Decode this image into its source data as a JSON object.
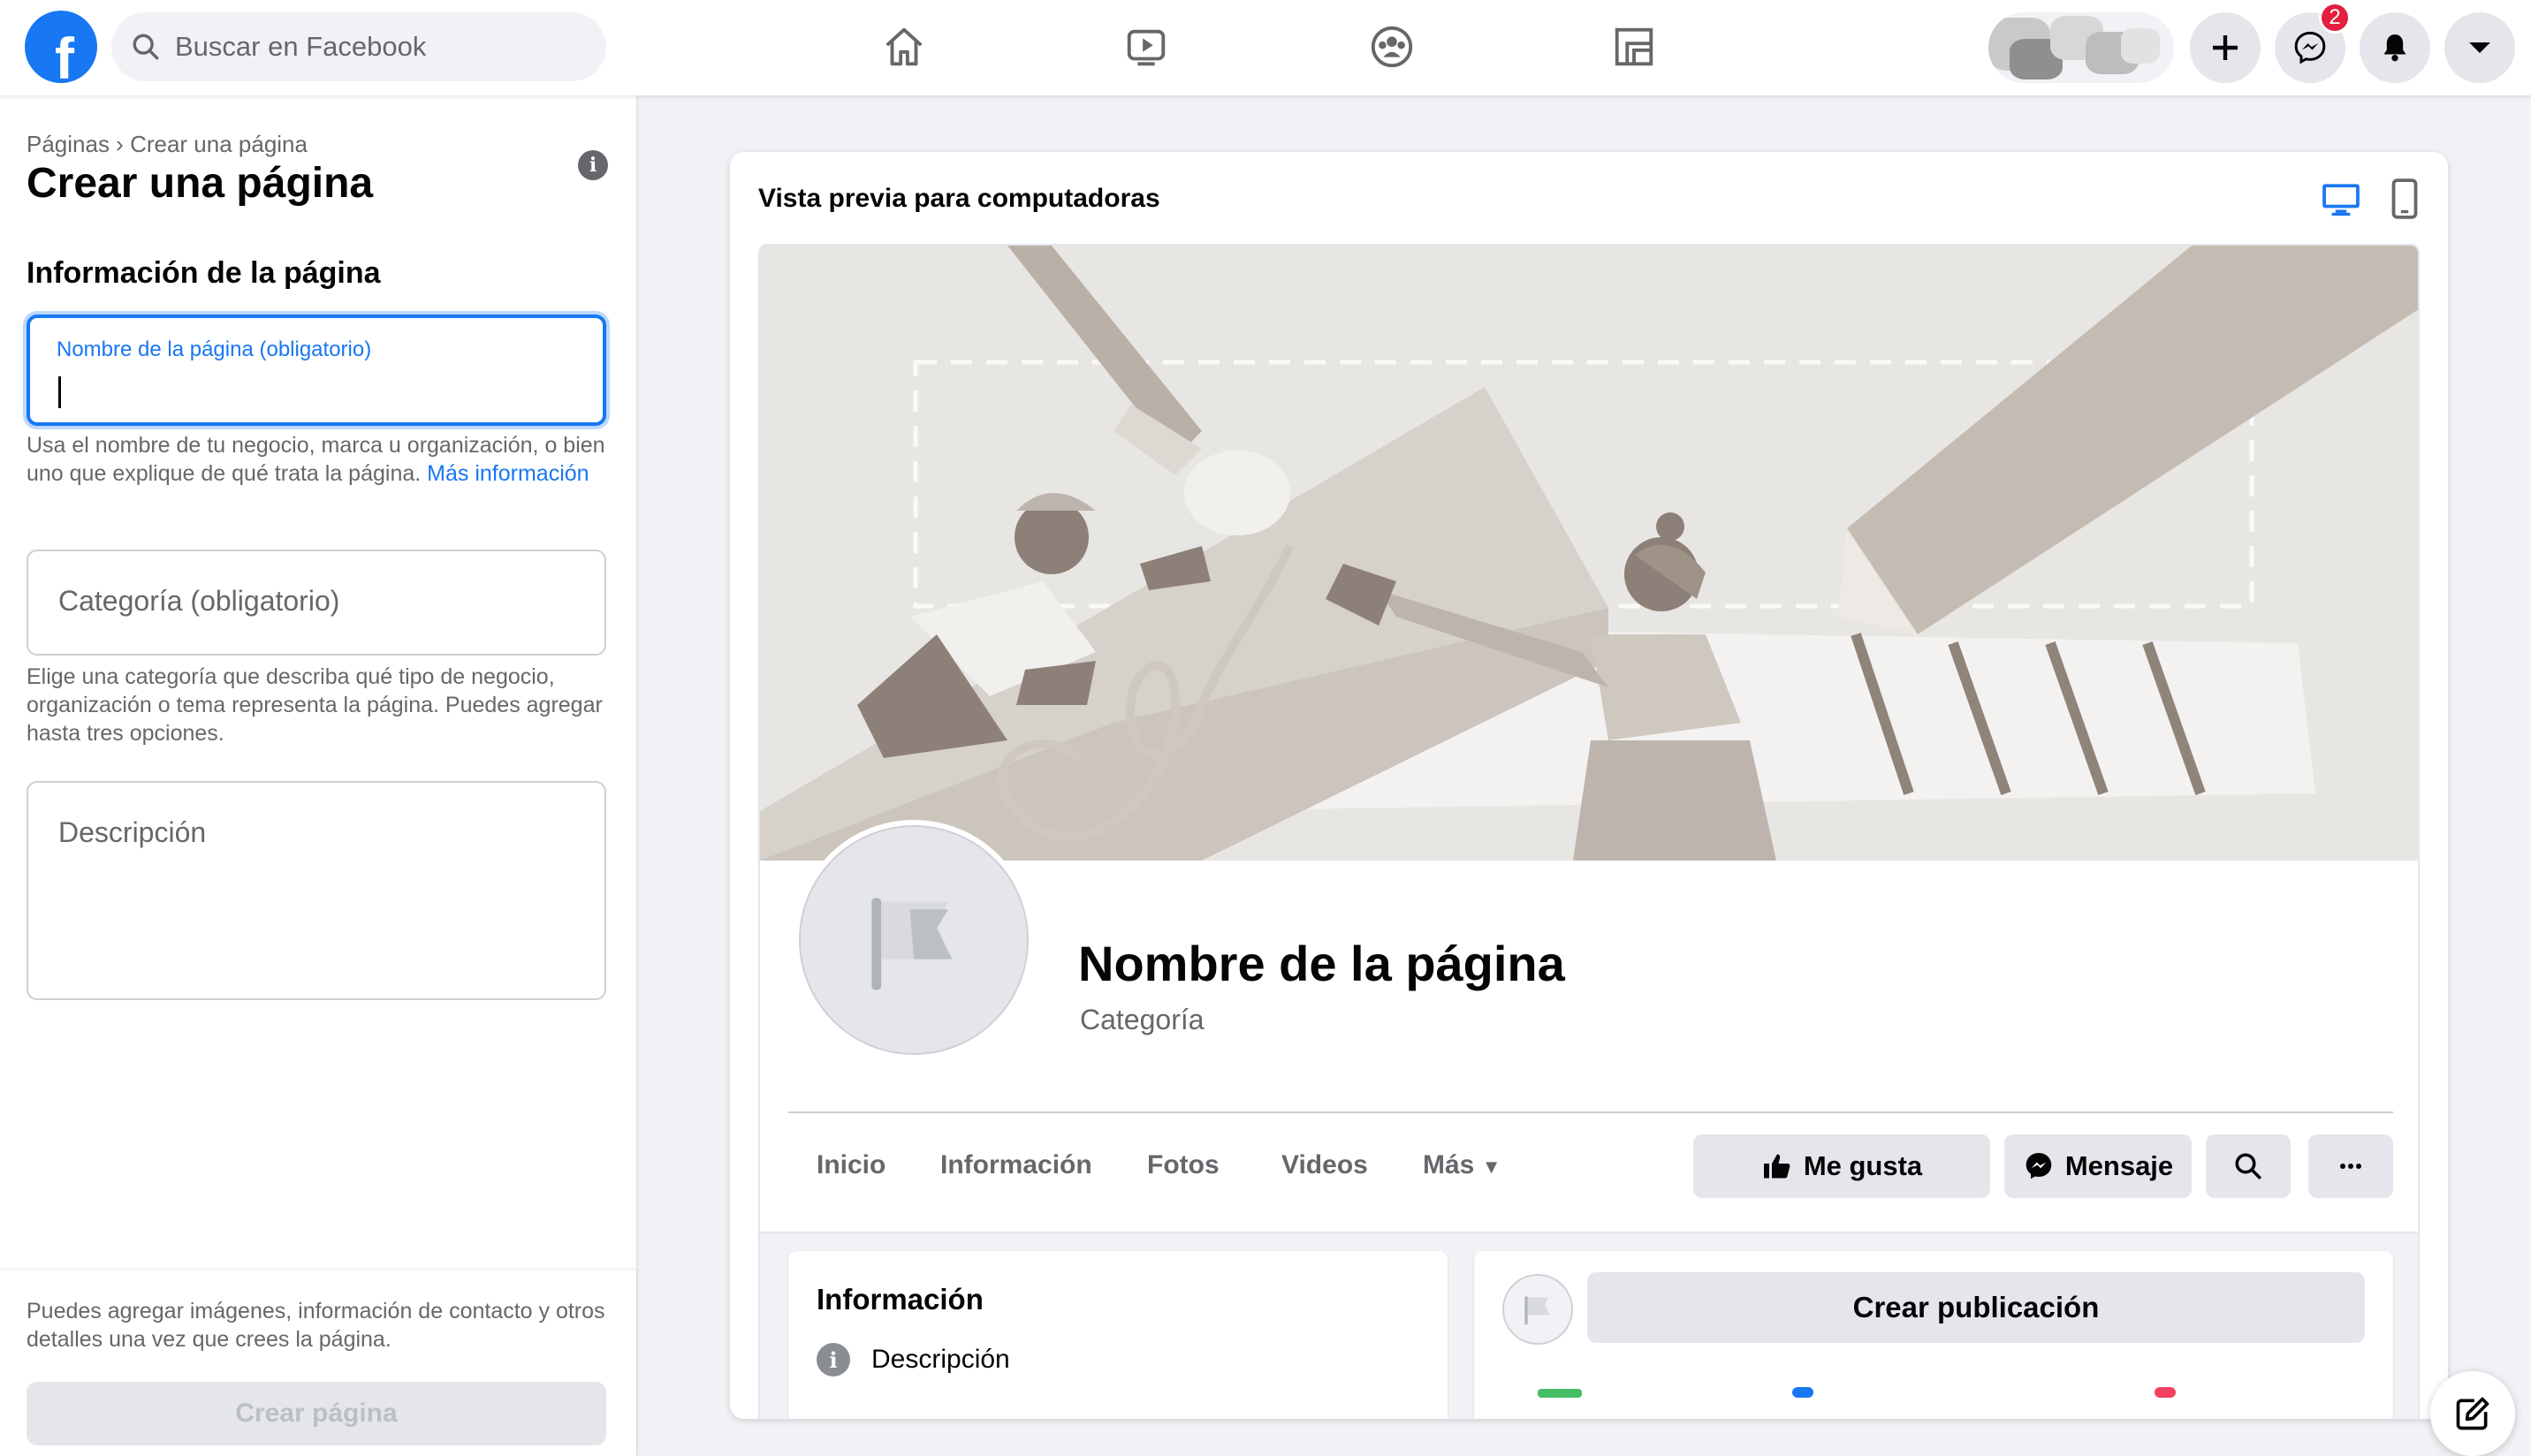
{
  "topbar": {
    "logo_letter": "f",
    "search_placeholder": "Buscar en Facebook",
    "nav": [
      "home-icon",
      "watch-icon",
      "groups-icon",
      "gaming-icon"
    ],
    "notification_count": "2"
  },
  "sidebar": {
    "breadcrumb": "Páginas › Crear una página",
    "title": "Crear una página",
    "section_title": "Información de la página",
    "name_field_label": "Nombre de la página (obligatorio)",
    "name_field_value": "",
    "name_helper": "Usa el nombre de tu negocio, marca u organización, o bien uno que explique de qué trata la página.",
    "name_helper_link": "Más información",
    "category_placeholder": "Categoría (obligatorio)",
    "category_helper": "Elige una categoría que describa qué tipo de negocio, organización o tema representa la página. Puedes agregar hasta tres opciones.",
    "description_placeholder": "Descripción",
    "footer_text": "Puedes agregar imágenes, información de contacto y otros detalles una vez que crees la página.",
    "create_button": "Crear página"
  },
  "preview": {
    "title": "Vista previa para computadoras",
    "page_name": "Nombre de la página",
    "category": "Categoría",
    "tabs": [
      "Inicio",
      "Información",
      "Fotos",
      "Videos",
      "Más"
    ],
    "like_button": "Me gusta",
    "message_button": "Mensaje",
    "info_card_title": "Información",
    "info_card_row": "Descripción",
    "create_post": "Crear publicación"
  },
  "colors": {
    "accent": "#1877f2",
    "background": "#f0f2f5",
    "badge": "#e41e3f"
  }
}
